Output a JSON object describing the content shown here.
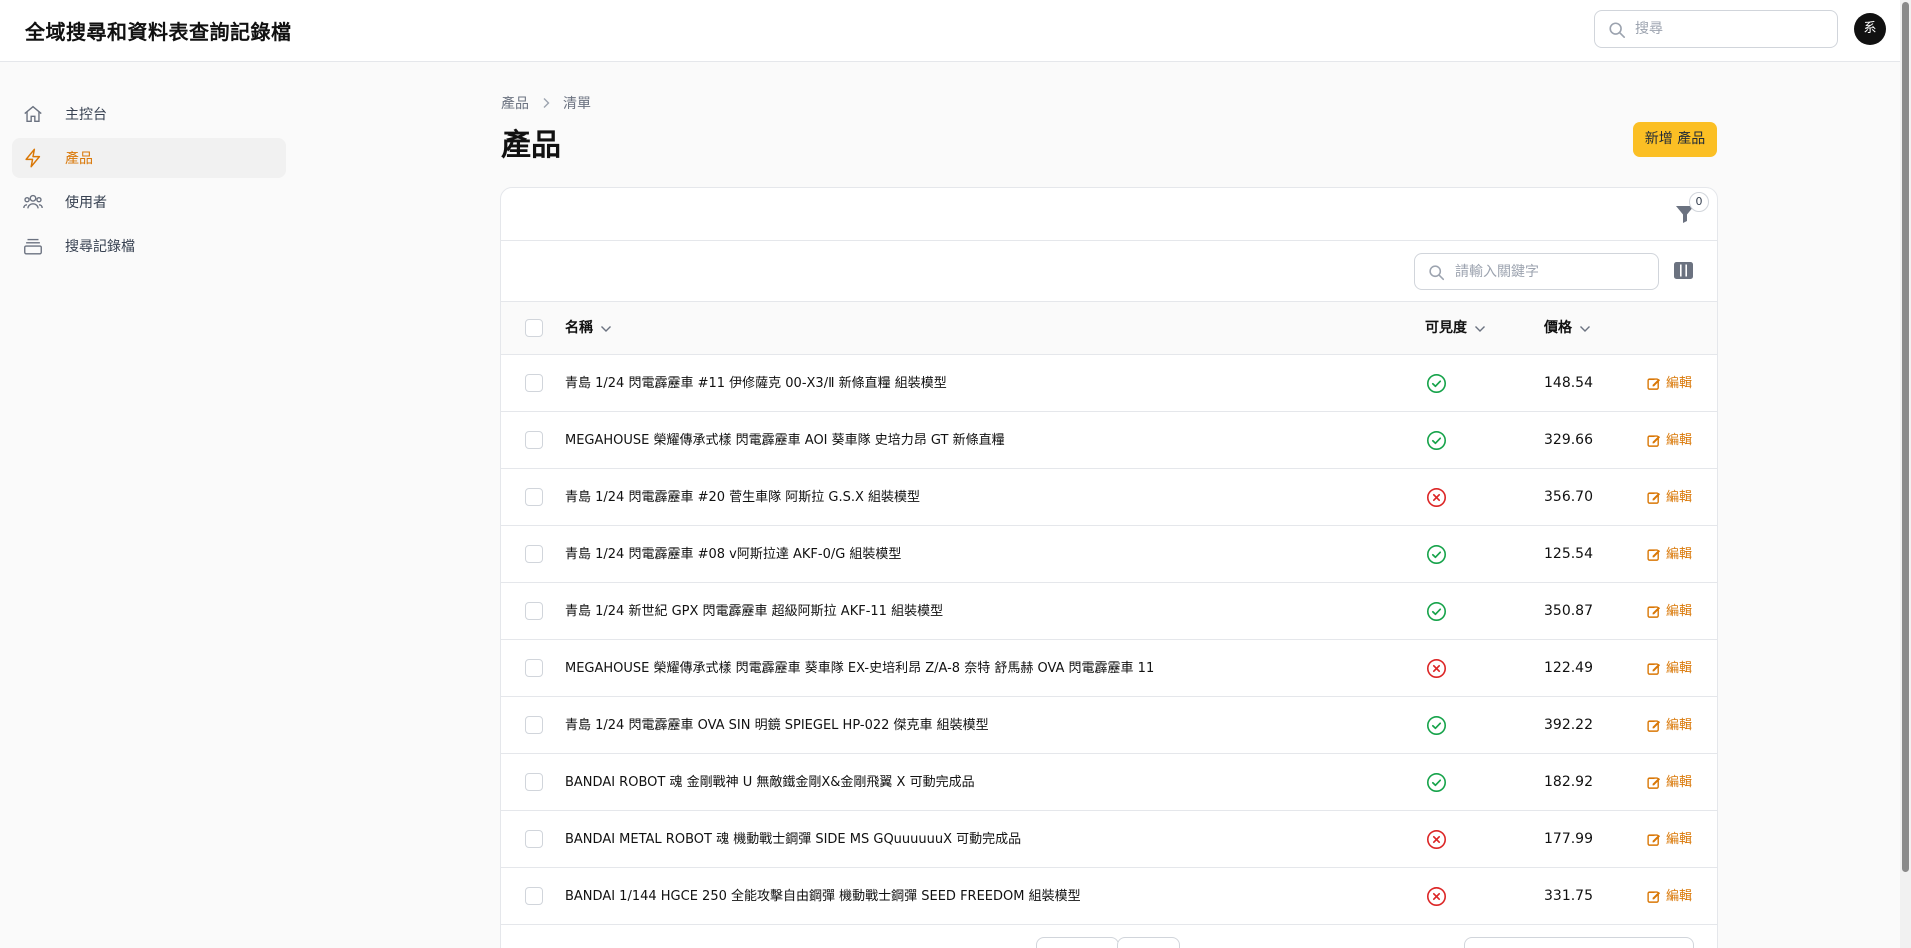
{
  "header": {
    "app_title": "全域搜尋和資料表查詢記錄檔",
    "search_placeholder": "搜尋",
    "avatar_initial": "系"
  },
  "sidebar": {
    "items": [
      {
        "label": "主控台",
        "icon": "home-icon",
        "active": false
      },
      {
        "label": "產品",
        "icon": "bolt-icon",
        "active": true
      },
      {
        "label": "使用者",
        "icon": "users-icon",
        "active": false
      },
      {
        "label": "搜尋記錄檔",
        "icon": "archive-icon",
        "active": false
      }
    ]
  },
  "breadcrumb": {
    "items": [
      "產品",
      "清單"
    ]
  },
  "page": {
    "title": "產品",
    "new_button": "新增 產品"
  },
  "table": {
    "filter_count": "0",
    "search_placeholder": "請輸入關鍵字",
    "columns": {
      "name": "名稱",
      "visibility": "可見度",
      "price": "價格"
    },
    "edit_label": "編輯",
    "rows": [
      {
        "name": "青島 1/24 閃電霹靂車 #11 伊修薩克 00-X3/Ⅱ 新條直糧 組裝模型",
        "visible": true,
        "price": "148.54"
      },
      {
        "name": "MEGAHOUSE 榮耀傳承式樣 閃電霹靂車 AOI 葵車隊 史培力昂 GT 新條直糧",
        "visible": true,
        "price": "329.66"
      },
      {
        "name": "青島 1/24 閃電霹靂車 #20 菅生車隊 阿斯拉 G.S.X 組裝模型",
        "visible": false,
        "price": "356.70"
      },
      {
        "name": "青島 1/24 閃電霹靂車 #08 v阿斯拉達 AKF-0/G 組裝模型",
        "visible": true,
        "price": "125.54"
      },
      {
        "name": "青島 1/24 新世紀 GPX 閃電霹靂車 超級阿斯拉 AKF-11 組裝模型",
        "visible": true,
        "price": "350.87"
      },
      {
        "name": "MEGAHOUSE 榮耀傳承式樣 閃電霹靂車 葵車隊 EX-史培利昂 Z/A-8 奈特 舒馬赫 OVA 閃電霹靂車 11",
        "visible": false,
        "price": "122.49"
      },
      {
        "name": "青島 1/24 閃電霹靂車 OVA SIN 明鏡 SPIEGEL HP-022 傑克車 組裝模型",
        "visible": true,
        "price": "392.22"
      },
      {
        "name": "BANDAI ROBOT 魂 金剛戰神 U 無敵鐵金剛X&金剛飛翼 X 可動完成品",
        "visible": true,
        "price": "182.92"
      },
      {
        "name": "BANDAI METAL ROBOT 魂 機動戰士鋼彈 SIDE MS GQuuuuuuX 可動完成品",
        "visible": false,
        "price": "177.99"
      },
      {
        "name": "BANDAI 1/144 HGCE 250 全能攻擊自由鋼彈 機動戰士鋼彈 SEED FREEDOM 組裝模型",
        "visible": false,
        "price": "331.75"
      }
    ]
  },
  "colors": {
    "accent": "#d97706",
    "primary_button": "#fbbf24",
    "visible_true": "#16a34a",
    "visible_false": "#dc2626"
  }
}
